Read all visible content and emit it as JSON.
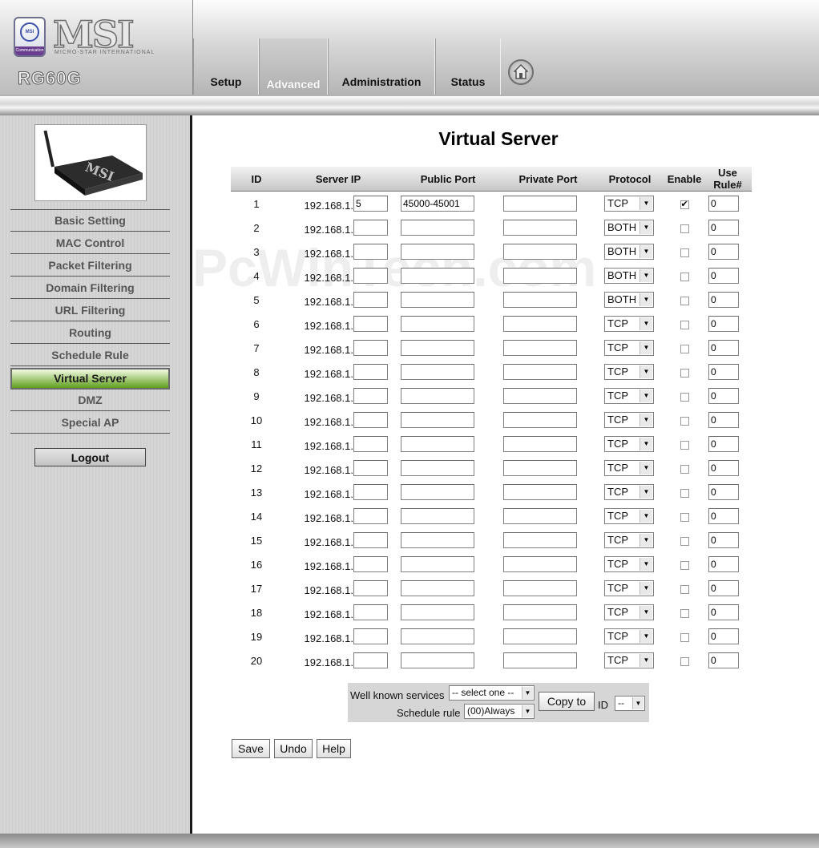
{
  "header": {
    "brand": "MSI",
    "brand_sub": "MICRO-STAR INTERNATIONAL",
    "badge_top": "MSI",
    "badge_bottom": "Communication",
    "model": "RG60G",
    "tabs": [
      {
        "label": "Setup"
      },
      {
        "label": "Advanced"
      },
      {
        "label": "Administration"
      },
      {
        "label": "Status"
      }
    ],
    "active_tab": "Advanced"
  },
  "sidebar": {
    "items": [
      {
        "label": "Basic Setting"
      },
      {
        "label": "MAC Control"
      },
      {
        "label": "Packet Filtering"
      },
      {
        "label": "Domain Filtering"
      },
      {
        "label": "URL Filtering"
      },
      {
        "label": "Routing"
      },
      {
        "label": "Schedule Rule"
      },
      {
        "label": "Virtual Server"
      },
      {
        "label": "DMZ"
      },
      {
        "label": "Special AP"
      }
    ],
    "active_item": "Virtual Server",
    "logout_label": "Logout"
  },
  "main": {
    "title": "Virtual Server",
    "watermark": "PcWinTech.com",
    "columns": [
      "ID",
      "Server IP",
      "Public Port",
      "Private Port",
      "Protocol",
      "Enable",
      "Use Rule#"
    ],
    "ip_prefix": "192.168.1.",
    "rows": [
      {
        "id": "1",
        "ip_last": "5",
        "public_port": "45000-45001",
        "private_port": "",
        "protocol": "TCP",
        "enabled": true,
        "rule": "0"
      },
      {
        "id": "2",
        "ip_last": "",
        "public_port": "",
        "private_port": "",
        "protocol": "BOTH",
        "enabled": false,
        "rule": "0"
      },
      {
        "id": "3",
        "ip_last": "",
        "public_port": "",
        "private_port": "",
        "protocol": "BOTH",
        "enabled": false,
        "rule": "0"
      },
      {
        "id": "4",
        "ip_last": "",
        "public_port": "",
        "private_port": "",
        "protocol": "BOTH",
        "enabled": false,
        "rule": "0"
      },
      {
        "id": "5",
        "ip_last": "",
        "public_port": "",
        "private_port": "",
        "protocol": "BOTH",
        "enabled": false,
        "rule": "0"
      },
      {
        "id": "6",
        "ip_last": "",
        "public_port": "",
        "private_port": "",
        "protocol": "TCP",
        "enabled": false,
        "rule": "0"
      },
      {
        "id": "7",
        "ip_last": "",
        "public_port": "",
        "private_port": "",
        "protocol": "TCP",
        "enabled": false,
        "rule": "0"
      },
      {
        "id": "8",
        "ip_last": "",
        "public_port": "",
        "private_port": "",
        "protocol": "TCP",
        "enabled": false,
        "rule": "0"
      },
      {
        "id": "9",
        "ip_last": "",
        "public_port": "",
        "private_port": "",
        "protocol": "TCP",
        "enabled": false,
        "rule": "0"
      },
      {
        "id": "10",
        "ip_last": "",
        "public_port": "",
        "private_port": "",
        "protocol": "TCP",
        "enabled": false,
        "rule": "0"
      },
      {
        "id": "11",
        "ip_last": "",
        "public_port": "",
        "private_port": "",
        "protocol": "TCP",
        "enabled": false,
        "rule": "0"
      },
      {
        "id": "12",
        "ip_last": "",
        "public_port": "",
        "private_port": "",
        "protocol": "TCP",
        "enabled": false,
        "rule": "0"
      },
      {
        "id": "13",
        "ip_last": "",
        "public_port": "",
        "private_port": "",
        "protocol": "TCP",
        "enabled": false,
        "rule": "0"
      },
      {
        "id": "14",
        "ip_last": "",
        "public_port": "",
        "private_port": "",
        "protocol": "TCP",
        "enabled": false,
        "rule": "0"
      },
      {
        "id": "15",
        "ip_last": "",
        "public_port": "",
        "private_port": "",
        "protocol": "TCP",
        "enabled": false,
        "rule": "0"
      },
      {
        "id": "16",
        "ip_last": "",
        "public_port": "",
        "private_port": "",
        "protocol": "TCP",
        "enabled": false,
        "rule": "0"
      },
      {
        "id": "17",
        "ip_last": "",
        "public_port": "",
        "private_port": "",
        "protocol": "TCP",
        "enabled": false,
        "rule": "0"
      },
      {
        "id": "18",
        "ip_last": "",
        "public_port": "",
        "private_port": "",
        "protocol": "TCP",
        "enabled": false,
        "rule": "0"
      },
      {
        "id": "19",
        "ip_last": "",
        "public_port": "",
        "private_port": "",
        "protocol": "TCP",
        "enabled": false,
        "rule": "0"
      },
      {
        "id": "20",
        "ip_last": "",
        "public_port": "",
        "private_port": "",
        "protocol": "TCP",
        "enabled": false,
        "rule": "0"
      }
    ]
  },
  "tools": {
    "well_known_label": "Well known services",
    "well_known_value": "-- select one --",
    "schedule_label": "Schedule rule",
    "schedule_value": "(00)Always",
    "copy_label": "Copy to",
    "id_label": "ID",
    "id_value": "--"
  },
  "buttons": {
    "save": "Save",
    "undo": "Undo",
    "help": "Help"
  },
  "colors": {
    "active_menu": "#5f9e1d",
    "sidebar_border": "#1a1a1a"
  },
  "icons": {
    "home": "home-icon",
    "dropdown": "chevron-down-icon",
    "check": "checkmark-icon"
  }
}
